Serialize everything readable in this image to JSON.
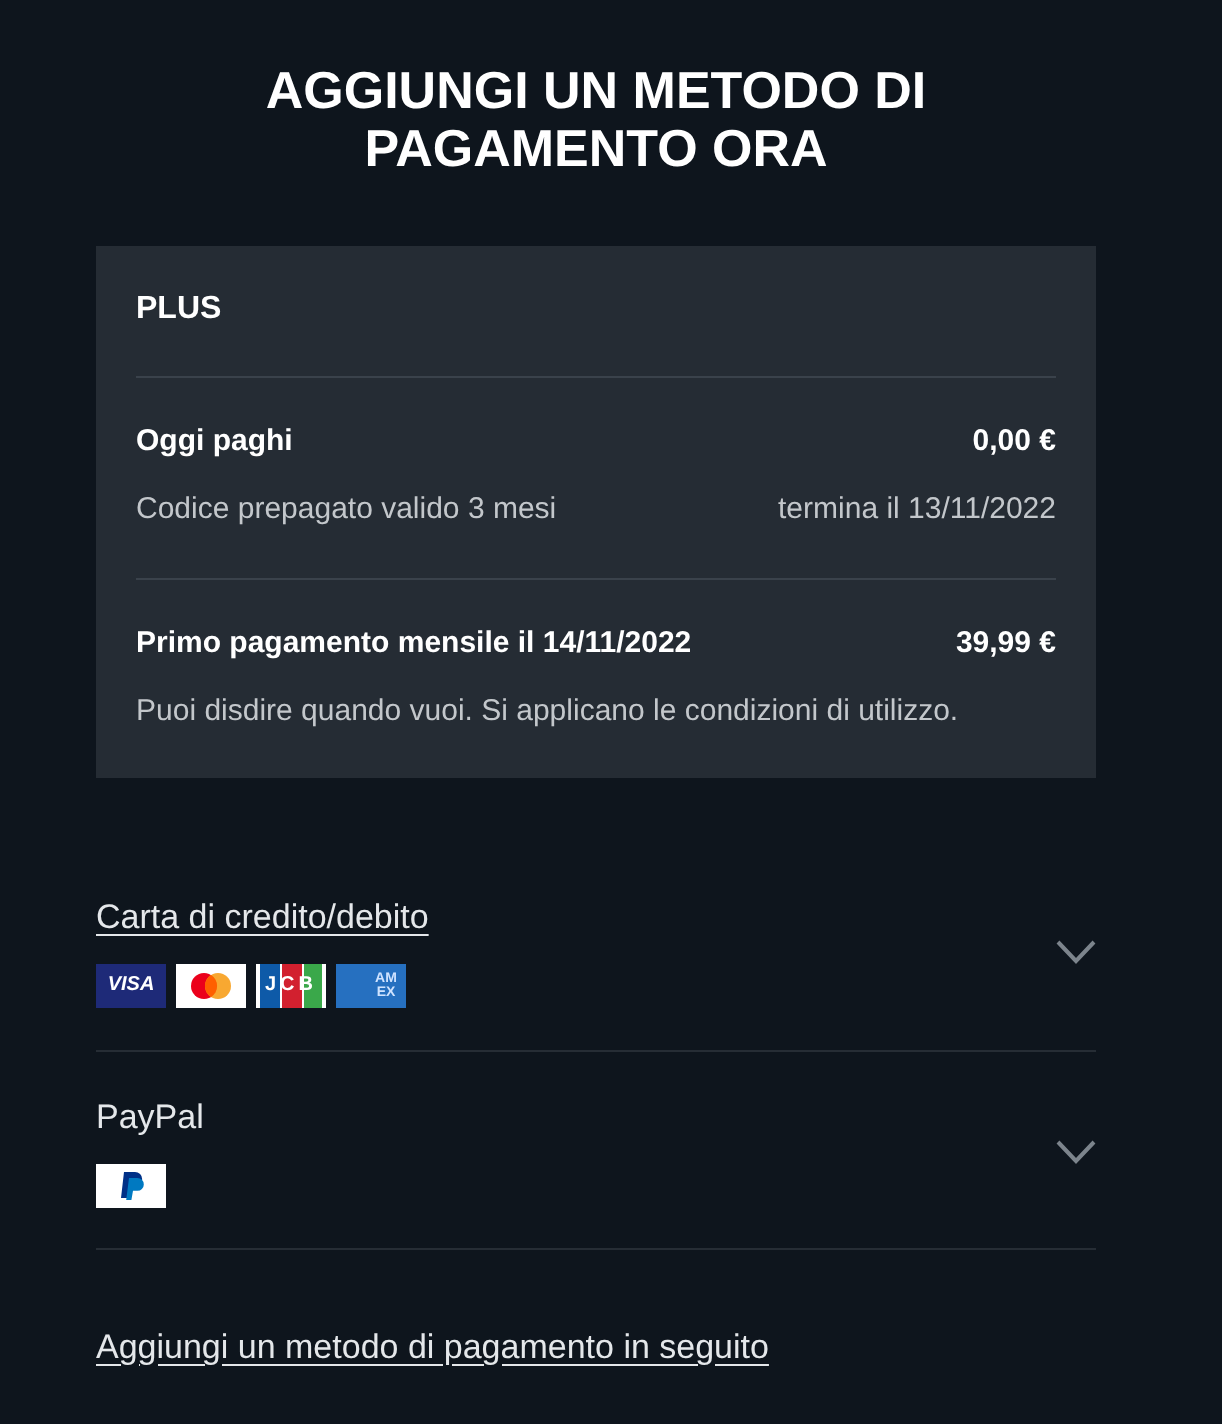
{
  "heading": "AGGIUNGI UN METODO DI PAGAMENTO ORA",
  "plan": {
    "name": "PLUS",
    "sections": [
      {
        "rows": [
          {
            "kind": "strong",
            "label": "Oggi paghi",
            "value": "0,00 €"
          },
          {
            "kind": "muted",
            "label": "Codice prepagato valido 3 mesi",
            "value": "termina il 13/11/2022"
          }
        ]
      },
      {
        "rows": [
          {
            "kind": "strong",
            "label": "Primo pagamento mensile il 14/11/2022",
            "value": "39,99 €"
          },
          {
            "kind": "muted",
            "label": "Puoi disdire quando vuoi. Si applicano le condizioni di utilizzo."
          }
        ]
      }
    ]
  },
  "payment_methods": [
    {
      "label": "Carta di credito/debito",
      "focused": true,
      "expanded": false,
      "logos": [
        {
          "kind": "visa",
          "text": "VISA"
        },
        {
          "kind": "mastercard"
        },
        {
          "kind": "jcb",
          "text": "JCB"
        },
        {
          "kind": "amex",
          "text": "AM EX"
        }
      ]
    },
    {
      "label": "PayPal",
      "focused": false,
      "expanded": false,
      "logos": [
        {
          "kind": "paypal"
        }
      ]
    }
  ],
  "later_link": "Aggiungi un metodo di pagamento in seguito"
}
